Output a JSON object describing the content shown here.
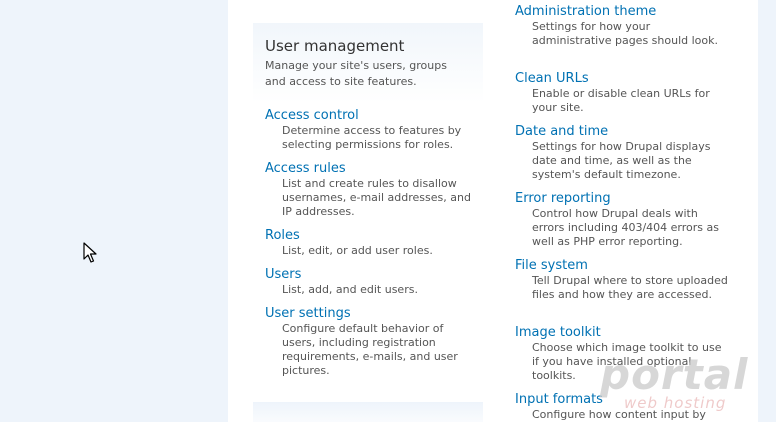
{
  "user_management": {
    "title": "User management",
    "description": "Manage your site's users, groups and access to site features.",
    "items": [
      {
        "label": "Access control",
        "description": "Determine access to features by selecting permissions for roles."
      },
      {
        "label": "Access rules",
        "description": "List and create rules to disallow usernames, e-mail addresses, and IP addresses."
      },
      {
        "label": "Roles",
        "description": "List, edit, or add user roles."
      },
      {
        "label": "Users",
        "description": "List, add, and edit users."
      },
      {
        "label": "User settings",
        "description": "Configure default behavior of users, including registration requirements, e-mails, and user pictures."
      }
    ]
  },
  "site_configuration": {
    "items": [
      {
        "label": "Administration theme",
        "description": "Settings for how your administrative pages should look."
      },
      {
        "label": "Clean URLs",
        "description": "Enable or disable clean URLs for your site."
      },
      {
        "label": "Date and time",
        "description": "Settings for how Drupal displays date and time, as well as the system's default timezone."
      },
      {
        "label": "Error reporting",
        "description": "Control how Drupal deals with errors including 403/404 errors as well as PHP error reporting."
      },
      {
        "label": "File system",
        "description": "Tell Drupal where to store uploaded files and how they are accessed."
      },
      {
        "label": "Image toolkit",
        "description": "Choose which image toolkit to use if you have installed optional toolkits."
      },
      {
        "label": "Input formats",
        "description": "Configure how content input by"
      }
    ]
  },
  "watermark": {
    "word": "portal",
    "subtitle": "web hosting"
  },
  "colors": {
    "link": "#0071b3",
    "text": "#555555",
    "page_background": "#eef4fb"
  }
}
